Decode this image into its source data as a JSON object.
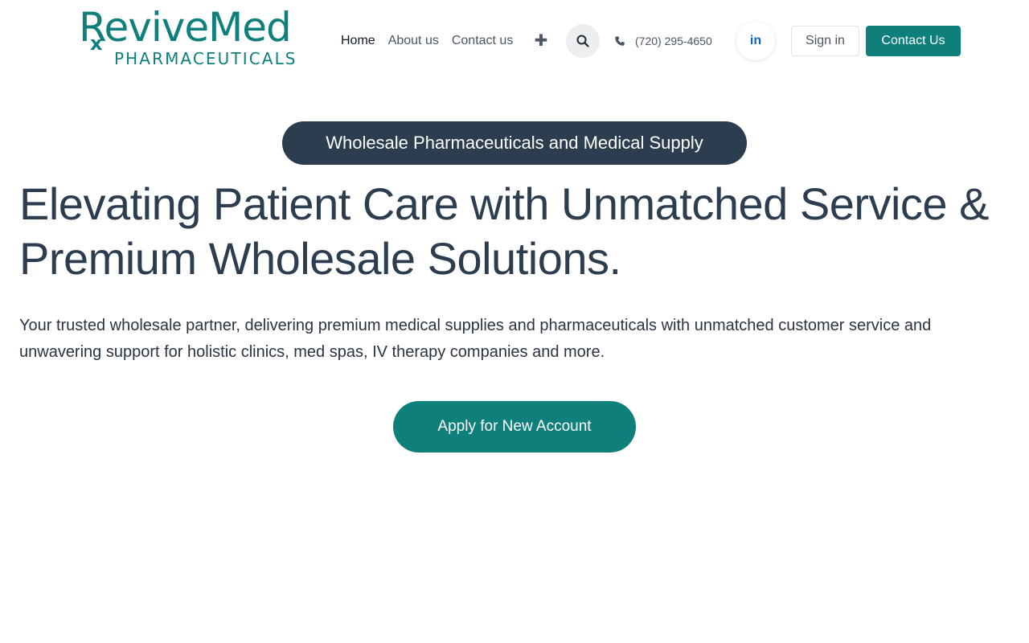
{
  "brand": {
    "name_top": "ReviveMed",
    "rx_mark": "x",
    "name_bottom": "PHARMACEUTICALS",
    "color": "#0e7f7a"
  },
  "nav": {
    "items": [
      {
        "label": "Home",
        "active": true
      },
      {
        "label": "About us",
        "active": false
      },
      {
        "label": "Contact us",
        "active": false
      }
    ],
    "more_icon": "plus-icon",
    "search_icon": "search-icon"
  },
  "contact": {
    "phone_icon": "phone-icon",
    "phone": "(720) 295-4650",
    "linkedin_label": "in"
  },
  "auth": {
    "signin_label": "Sign in",
    "contact_label": "Contact Us"
  },
  "hero": {
    "badge": "Wholesale Pharmaceuticals and Medical Supply",
    "headline": "Elevating Patient Care with Unmatched Service & Premium Wholesale Solutions.",
    "subtext": "Your trusted wholesale partner, delivering premium medical supplies and pharmaceuticals with unmatched customer service and unwavering support for holistic clinics, med spas, IV therapy companies and more.",
    "cta": "Apply for New Account"
  },
  "colors": {
    "accent": "#0e7f7a",
    "dark": "#2c3d50",
    "linkedin": "#0a66c2"
  }
}
